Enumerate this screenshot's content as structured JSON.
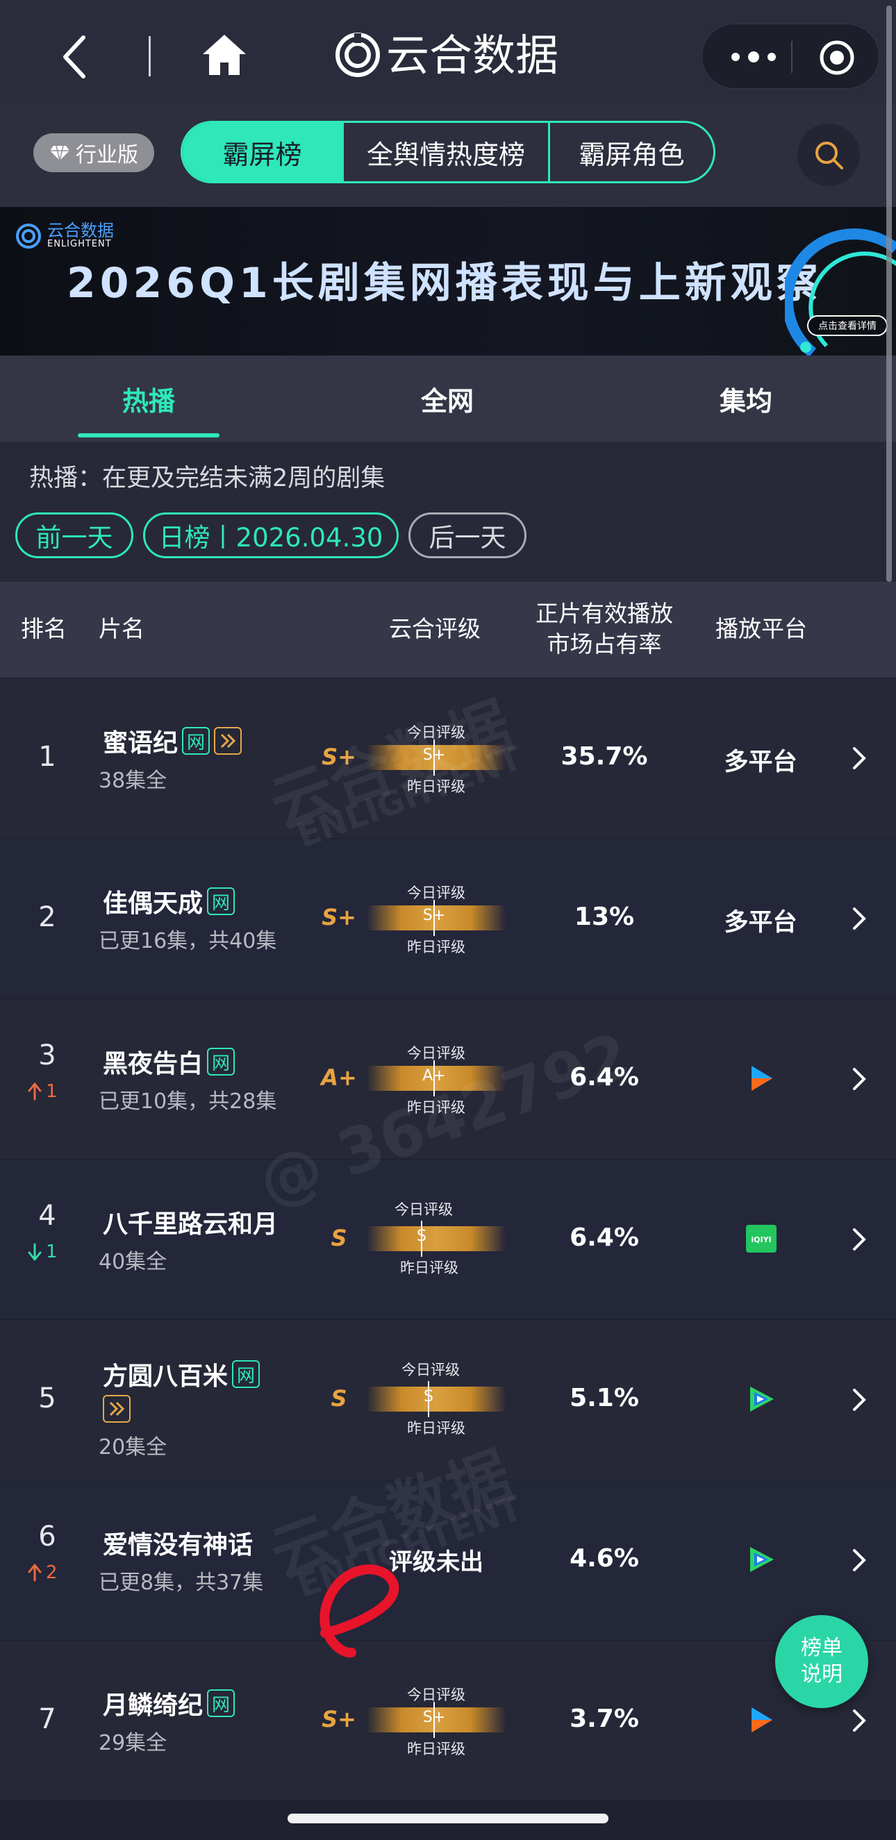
{
  "nav": {
    "title": "云合数据"
  },
  "header": {
    "industry_badge": "行业版",
    "segments": [
      "霸屏榜",
      "全舆情热度榜",
      "霸屏角色"
    ]
  },
  "banner": {
    "logo_cn": "云合数据",
    "logo_en": "ENLIGHTENT",
    "title": "2026Q1长剧集网播表现与上新观察",
    "detail": "点击查看详情"
  },
  "subtabs": [
    "热播",
    "全网",
    "集均"
  ],
  "description": "热播：在更及完结未满2周的剧集",
  "date_nav": {
    "prev": "前一天",
    "current": "日榜丨2026.04.30",
    "next": "后一天"
  },
  "table_header": {
    "rank": "排名",
    "title": "片名",
    "rating": "云合评级",
    "share_line1": "正片有效播放",
    "share_line2": "市场占有率",
    "platform": "播放平台"
  },
  "rating_labels": {
    "today": "今日评级",
    "yesterday": "昨日评级",
    "pending": "评级未出"
  },
  "rows": [
    {
      "rank": "1",
      "change": "",
      "title": "蜜语纪",
      "tags": [
        "网",
        "play"
      ],
      "sub": "38集全",
      "grade": "S+",
      "grade_today": "S+",
      "share": "35.7%",
      "platform": "多平台",
      "platform_icon": ""
    },
    {
      "rank": "2",
      "change": "",
      "title": "佳偶天成",
      "tags": [
        "网"
      ],
      "sub": "已更16集，共40集",
      "grade": "S+",
      "grade_today": "S+",
      "share": "13%",
      "platform": "多平台",
      "platform_icon": ""
    },
    {
      "rank": "3",
      "change": "1",
      "change_dir": "up",
      "title": "黑夜告白",
      "tags": [
        "网"
      ],
      "sub": "已更10集，共28集",
      "grade": "A+",
      "grade_today": "A+",
      "share": "6.4%",
      "platform": "",
      "platform_icon": "youku-icon"
    },
    {
      "rank": "4",
      "change": "1",
      "change_dir": "down",
      "title": "八千里路云和月",
      "tags": [],
      "sub": "40集全",
      "grade": "S",
      "grade_today": "S",
      "share": "6.4%",
      "platform": "",
      "platform_icon": "iqiyi-icon"
    },
    {
      "rank": "5",
      "change": "",
      "title": "方圆八百米",
      "tags": [
        "网",
        "play"
      ],
      "sub": "20集全",
      "grade": "S",
      "grade_today": "S",
      "share": "5.1%",
      "platform": "",
      "platform_icon": "tencent-video-icon"
    },
    {
      "rank": "6",
      "change": "2",
      "change_dir": "up",
      "title": "爱情没有神话",
      "tags": [],
      "sub": "已更8集，共37集",
      "grade": "",
      "grade_today": "",
      "share": "4.6%",
      "platform": "",
      "platform_icon": "tencent-video-icon"
    },
    {
      "rank": "7",
      "change": "",
      "title": "月鳞绮纪",
      "tags": [
        "网"
      ],
      "sub": "29集全",
      "grade": "S+",
      "grade_today": "S+",
      "share": "3.7%",
      "platform": "",
      "platform_icon": "youku-icon"
    }
  ],
  "watermarks": [
    "云合数据",
    "ENLIGHTENT",
    "@ 3642792"
  ],
  "float_button": {
    "line1": "榜单",
    "line2": "说明"
  },
  "colors": {
    "accent": "#2ee8b8",
    "grade": "#e9a341",
    "up": "#ee6a40",
    "down": "#34d9a8"
  }
}
